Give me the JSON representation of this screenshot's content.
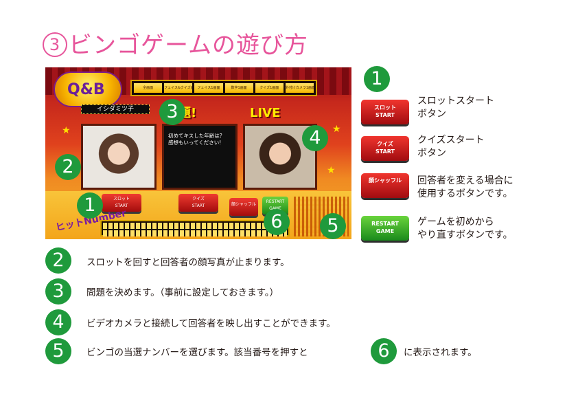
{
  "page": {
    "title_num": "3",
    "title": "ビンゴゲームの遊び方"
  },
  "screenshot": {
    "logo_text": "Q&B",
    "menu": [
      "全画面",
      "フェイス&クイズ画面",
      "フェイス1画面",
      "数字1画面",
      "クイズ1画面",
      "外付けカメラ1画面"
    ],
    "respondent_name": "イシダミツ子",
    "question_heading": "問題!",
    "question_text": "初めてキスした年齢は？\n感想もいってください!",
    "live_label": "LIVE",
    "btn_slot": "スロット\nSTART",
    "btn_quiz": "クイズ\nSTART",
    "btn_shuffle": "顔シャッフル",
    "btn_restart": "RESTART\nGAME",
    "hit_number_label": "ヒットNumber"
  },
  "markers": [
    "1",
    "2",
    "3",
    "4",
    "5",
    "6"
  ],
  "legend": [
    {
      "num": "1",
      "button": "スロット\nSTART",
      "text": "スロットスタート\nボタン",
      "color": "red"
    },
    {
      "button": "クイズ\nSTART",
      "text": "クイズスタート\nボタン",
      "color": "red"
    },
    {
      "button": "顔シャッフル",
      "text": "回答者を変える場合に\n使用するボタンです。",
      "color": "red"
    },
    {
      "button": "RESTART\nGAME",
      "text": "ゲームを初めから\nやり直すボタンです。",
      "color": "green"
    }
  ],
  "descriptions": [
    {
      "num": "2",
      "text": "スロットを回すと回答者の顔写真が止まります。"
    },
    {
      "num": "3",
      "text": "問題を決めます。（事前に設定しておきます。）"
    },
    {
      "num": "4",
      "text": "ビデオカメラと接続して回答者を映し出すことができます。"
    },
    {
      "num": "5",
      "text": "ビンゴの当選ナンバーを選びます。該当番号を押すと",
      "inline_num": "6",
      "suffix": "に表示されます。"
    }
  ],
  "colors": {
    "title": "#e7559b",
    "marker": "#1f9a3c",
    "button_red": "#d3201c",
    "button_green": "#3aa82a"
  }
}
